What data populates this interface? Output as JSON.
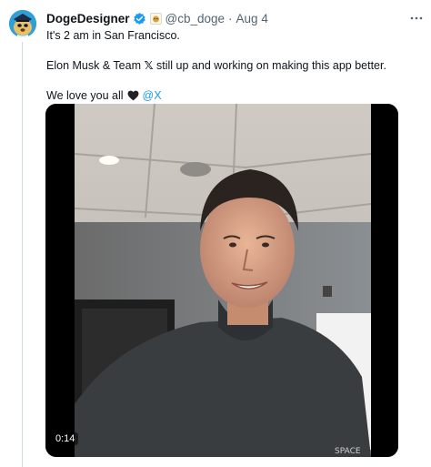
{
  "tweet": {
    "author_name": "DogeDesigner",
    "handle": "@cb_doge",
    "separator": "·",
    "date": "Aug 4",
    "lines": {
      "line1": "It's 2 am in San Francisco.",
      "line2_prefix": "Elon Musk & Team",
      "line2_x": "𝕏",
      "line2_suffix": "still up and working on making this app better.",
      "line3_text": "We love you all",
      "mention": "@X"
    }
  },
  "media": {
    "duration": "0:14",
    "watermark": "SPACE"
  },
  "colors": {
    "accent": "#1d9bf0",
    "secondary_text": "#536471",
    "divider": "#cfd9de"
  },
  "icons": {
    "verified": "verified-badge-icon",
    "affiliation": "affiliate-badge-icon",
    "more": "more-options-icon",
    "heart": "black-heart-icon"
  }
}
